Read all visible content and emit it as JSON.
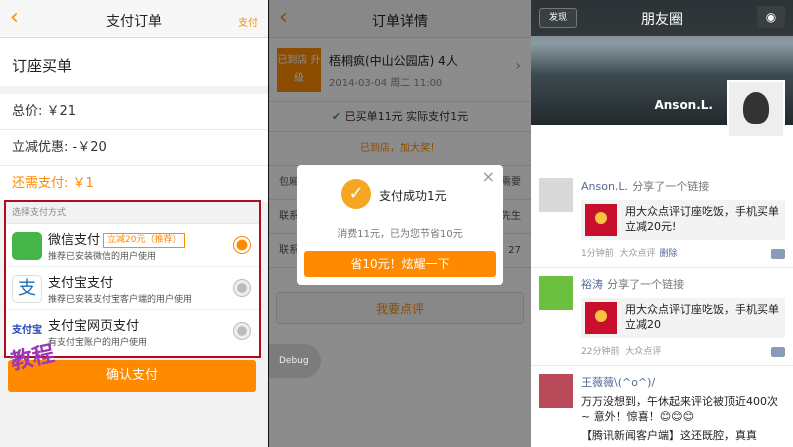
{
  "panel1": {
    "back_icon": "chevron-left-icon",
    "title": "支付订单",
    "right": "支付",
    "order_name": "订座买单",
    "total": "总价: ￥21",
    "discount": "立减优惠: -￥20",
    "due_label": "还需支付:",
    "due_value": "￥1",
    "section": "选择支付方式",
    "options": [
      {
        "name": "微信支付",
        "tag": "立减20元（推荐）",
        "desc": "推荐已安装微信的用户使用",
        "icon": "wechat-icon",
        "selected": true
      },
      {
        "name": "支付宝支付",
        "tag": "",
        "desc": "推荐已安装支付宝客户端的用户使用",
        "icon": "alipay-icon",
        "selected": false
      },
      {
        "name": "支付宝网页支付",
        "tag": "",
        "desc": "有支付宝账户的用户使用",
        "icon": "alipay-web-icon",
        "selected": false
      }
    ],
    "confirm": "确认支付",
    "watermark": "教程",
    "accent": "#ff8a00",
    "highlight_border": "#b20b1e"
  },
  "panel2": {
    "title": "订单详情",
    "shop_badge": "已到店 升级",
    "shop_name": "梧桐疯(中山公园店) 4人",
    "shop_date": "2014-03-04 周二 11:00",
    "paid_text": "已买单11元 实际支付1元",
    "brand_text": "已到店，加大奖！",
    "rows": [
      {
        "left": "包厢",
        "right": "需要"
      },
      {
        "left": "联系",
        "right": "先生"
      },
      {
        "left": "联系",
        "right": "27"
      }
    ],
    "review": "我要点评",
    "debug": "Debug",
    "modal": {
      "close": "×",
      "title": "支付成功1元",
      "sub": "消费11元，已为您节省10元",
      "share": "省10元！炫耀一下"
    }
  },
  "panel3": {
    "discover": "发现",
    "title": "朋友圈",
    "camera_icon": "camera-icon",
    "user": "Anson.L.",
    "posts": [
      {
        "who": "Anson.L.",
        "act": "分享了一个链接",
        "card": "用大众点评订座吃饭，手机买单立减20元!",
        "time": "1分钟前",
        "src": "大众点评",
        "del": "删除"
      },
      {
        "who": "裕涛",
        "act": "分享了一个链接",
        "card": "用大众点评订座吃饭，手机买单立减20",
        "time": "22分钟前",
        "src": "大众点评",
        "del": ""
      },
      {
        "who": "王薇薇\\(^o^)/",
        "act": "",
        "body": "万万没想到，午休起来评论被顶近400次~ 意外！惊喜！😊😊😊",
        "extra": "【腾讯新闻客户端】这还既腔，真真"
      }
    ]
  }
}
